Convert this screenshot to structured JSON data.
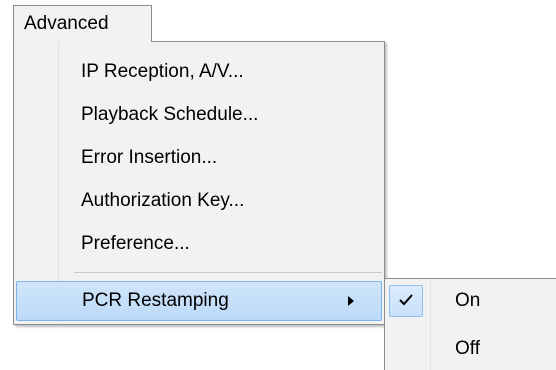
{
  "menubar": {
    "advanced_label": "Advanced"
  },
  "advanced_menu": {
    "items": [
      {
        "label": "IP Reception, A/V..."
      },
      {
        "label": "Playback Schedule..."
      },
      {
        "label": "Error Insertion..."
      },
      {
        "label": "Authorization Key..."
      },
      {
        "label": "Preference..."
      }
    ],
    "pcr_item": {
      "label": "PCR Restamping",
      "submenu_icon": "triangle-right-icon"
    }
  },
  "pcr_submenu": {
    "items": [
      {
        "label": "On",
        "checked": true,
        "icon": "checkmark-icon"
      },
      {
        "label": "Off",
        "checked": false
      }
    ]
  },
  "colors": {
    "menu_bg": "#f2f2f2",
    "highlight_bg": "#c5def9",
    "highlight_border": "#7eb4ea",
    "border": "#8c8c8c"
  }
}
